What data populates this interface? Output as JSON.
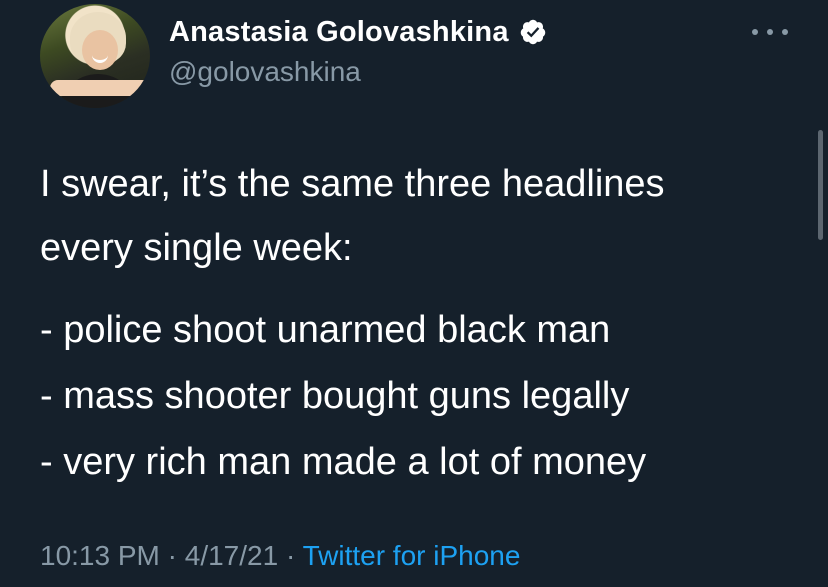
{
  "user": {
    "display_name": "Anastasia Golovashkina",
    "handle": "@golovashkina",
    "verified_icon": "verified-badge-icon",
    "avatar": "profile-photo"
  },
  "tweet": {
    "lines": [
      "I swear, it’s the same three headlines",
      "every single week:",
      "- police shoot unarmed black man",
      "- mass shooter bought guns legally",
      "- very rich man made a lot of money"
    ]
  },
  "meta": {
    "time": "10:13 PM",
    "separator1": " · ",
    "date": "4/17/21",
    "separator2": " · ",
    "source": "Twitter for iPhone"
  },
  "colors": {
    "background": "#15202b",
    "text": "#ffffff",
    "secondary": "#8899a6",
    "link": "#1da1f2"
  },
  "more_menu_icon": "ellipsis-icon"
}
